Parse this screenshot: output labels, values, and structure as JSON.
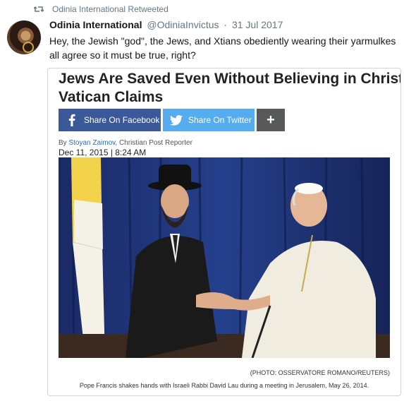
{
  "retweet": {
    "label": "Odinia International Retweeted",
    "icon": "retweet-icon"
  },
  "tweet": {
    "author_name": "Odinia International",
    "author_handle": "@OdiniaInvictus",
    "separator": "·",
    "date": "31 Jul 2017",
    "text": "Hey, the Jewish \"god\", the Jews, and Xtians obediently wearing their yarmulkes all agree so it must be true, right?"
  },
  "article": {
    "headline_line1": "Jews Are Saved Even Without Believing in Christ,",
    "headline_line2": "Vatican Claims",
    "share": {
      "facebook_label": "Share On Facebook",
      "twitter_label": "Share On Twitter",
      "more_label": "+"
    },
    "byline_prefix": "By",
    "author": "Stoyan Zaimov",
    "author_role": ", Christian Post Reporter",
    "date": "Dec 11, 2015 | 8:24 AM",
    "photo_credit": "(PHOTO: OSSERVATORE ROMANO/REUTERS)",
    "caption": "Pope Francis shakes hands with Israeli Rabbi David Lau during a meeting in Jerusalem, May 26, 2014."
  },
  "colors": {
    "facebook": "#3b5998",
    "twitter": "#55acee",
    "more": "#58595b",
    "muted": "#657786"
  }
}
